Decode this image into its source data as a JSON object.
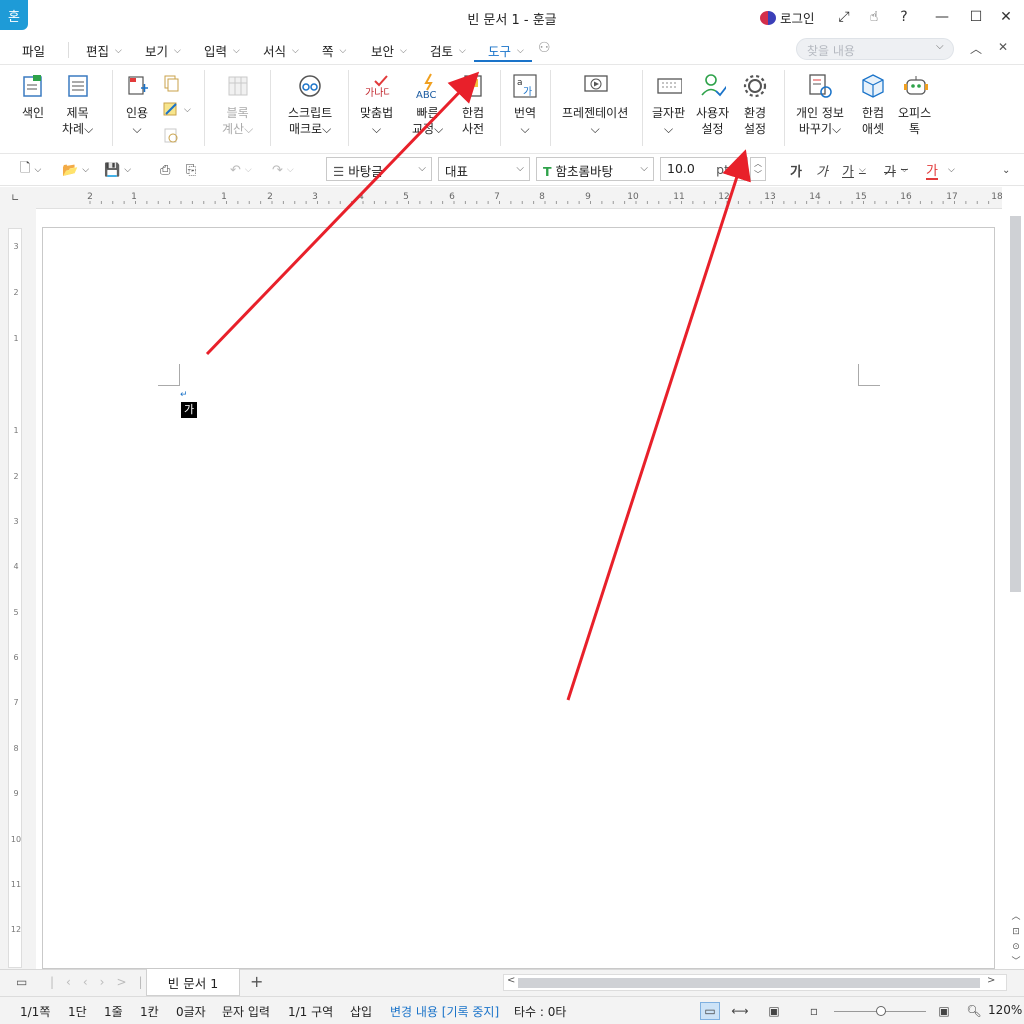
{
  "title": {
    "app_logo": "혼",
    "window_title": "빈 문서 1 - 훈글",
    "login": "로그인"
  },
  "menu": {
    "file": "파일",
    "edit": "편집",
    "view": "보기",
    "input": "입력",
    "format": "서식",
    "page": "쪽",
    "security": "보안",
    "review": "검토",
    "tools": "도구",
    "search_placeholder": "찾을 내용"
  },
  "ribbon": {
    "index": "색인",
    "toc": [
      "제목",
      "차례"
    ],
    "cite": "인용",
    "block_calc": [
      "블록",
      "계산"
    ],
    "script_macro": [
      "스크립트",
      "매크로"
    ],
    "spell": "맞춤법",
    "spell_icon_text": "가나다",
    "quick_correct": [
      "빠른",
      "교정"
    ],
    "quick_icon_text": "ABC",
    "hancom_dict": [
      "한컴",
      "사전"
    ],
    "translate": "번역",
    "presentation": "프레젠테이션",
    "keyboard": "글자판",
    "user_settings": [
      "사용자",
      "설정"
    ],
    "env_settings": [
      "환경",
      "설정"
    ],
    "personal_info": [
      "개인 정보",
      "바꾸기"
    ],
    "hancom_asset": [
      "한컴",
      "애셋"
    ],
    "office_talk": [
      "오피스",
      "톡"
    ]
  },
  "format": {
    "style": "바탕글",
    "lang": "대표",
    "font": "함초롬바탕",
    "size": "10.0",
    "unit": "pt",
    "bold_glyph": "가",
    "italic_glyph": "가",
    "underline_glyph": "가",
    "strike_glyph": "가",
    "color_glyph": "가"
  },
  "ruler": {
    "ticks": [
      "2",
      "1",
      "1",
      "2",
      "3",
      "4",
      "5",
      "6",
      "7",
      "8",
      "9",
      "10",
      "11",
      "12",
      "13",
      "14",
      "15",
      "16",
      "17",
      "18"
    ],
    "vticks": [
      "3",
      "2",
      "1",
      "1",
      "2",
      "3",
      "4",
      "5",
      "6",
      "7",
      "8",
      "9",
      "10",
      "11",
      "12"
    ]
  },
  "document": {
    "cursor_char": "가"
  },
  "tabs": {
    "doc_tab": "빈 문서 1",
    "add": "+"
  },
  "status": {
    "page": "1/1쪽",
    "column": "1단",
    "line": "1줄",
    "col": "1칸",
    "chars": "0글자",
    "mode": "문자 입력",
    "section": "1/1 구역",
    "insert": "삽입",
    "track": "변경 내용 [기록 중지]",
    "keystrokes": "타수 : 0타",
    "zoom": "120%"
  },
  "colors": {
    "accent": "#1a73c9",
    "annotation_arrow": "#e8202a"
  }
}
